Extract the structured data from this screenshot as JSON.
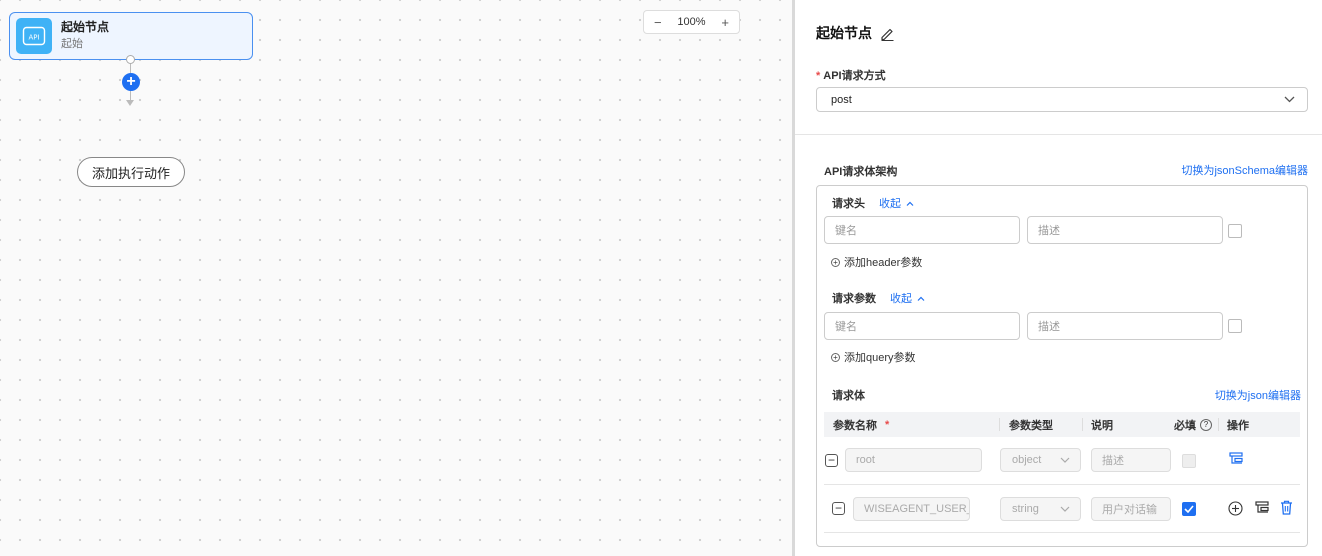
{
  "canvas": {
    "start_node": {
      "title": "起始节点",
      "subtitle": "起始",
      "icon": "api-icon"
    },
    "add_action_label": "添加执行动作",
    "zoom": {
      "minus": "−",
      "value": "100%",
      "plus": "+"
    }
  },
  "panel": {
    "title": "起始节点",
    "method": {
      "required_mark": "*",
      "label": "API请求方式",
      "value": "post"
    },
    "schema": {
      "title": "API请求体架构",
      "switch_label": "切换为jsonSchema编辑器",
      "headers": {
        "label": "请求头",
        "collapse": "收起",
        "key_placeholder": "键名",
        "desc_placeholder": "描述",
        "add_label": "添加header参数"
      },
      "query": {
        "label": "请求参数",
        "collapse": "收起",
        "key_placeholder": "键名",
        "desc_placeholder": "描述",
        "add_label": "添加query参数"
      },
      "body": {
        "label": "请求体",
        "switch_label": "切换为json编辑器",
        "columns": {
          "name": "参数名称",
          "name_required": "*",
          "type": "参数类型",
          "desc": "说明",
          "required": "必填",
          "help": "?",
          "ops": "操作"
        },
        "rows": [
          {
            "name": "root",
            "type": "object",
            "desc": "描述",
            "required": false
          },
          {
            "name": "WISEAGENT_USER_",
            "type": "string",
            "desc": "用户对话输",
            "required": true
          }
        ]
      }
    }
  },
  "colors": {
    "accent": "#1e6ff1",
    "required": "#e84a4a",
    "node_icon": "#3fb2f6"
  }
}
